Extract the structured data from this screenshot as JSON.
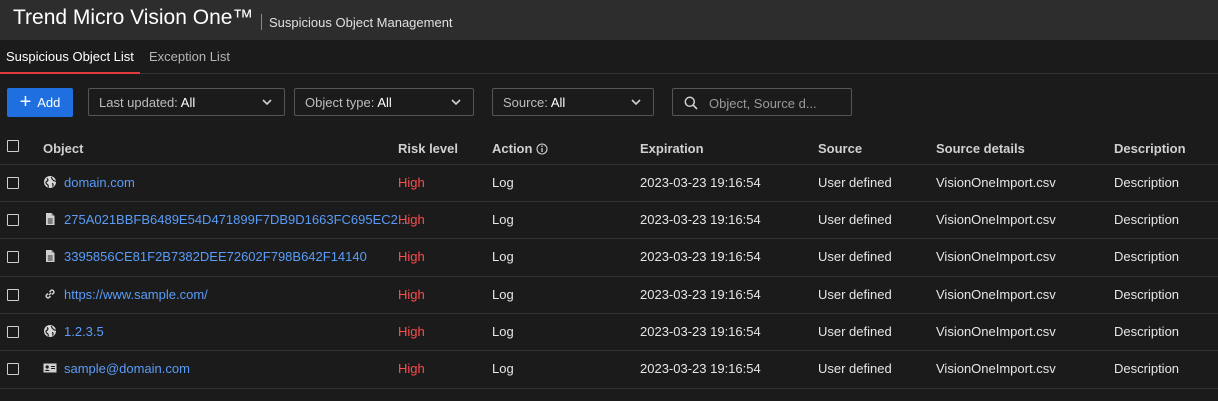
{
  "header": {
    "app_title": "Trend Micro Vision One™",
    "page_title": "Suspicious Object Management"
  },
  "tabs": [
    {
      "label": "Suspicious Object List",
      "active": true
    },
    {
      "label": "Exception List",
      "active": false
    }
  ],
  "toolbar": {
    "add_label": "Add",
    "filters": [
      {
        "label": "Last updated:",
        "value": "All"
      },
      {
        "label": "Object type:",
        "value": "All"
      },
      {
        "label": "Source:",
        "value": "All"
      }
    ],
    "search_placeholder": "Object, Source d..."
  },
  "table": {
    "columns": [
      "Object",
      "Risk level",
      "Action",
      "Expiration",
      "Source",
      "Source details",
      "Description"
    ],
    "rows": [
      {
        "icon": "globe-icon",
        "object": "domain.com",
        "risk": "High",
        "action": "Log",
        "expiration": "2023-03-23 19:16:54",
        "source": "User defined",
        "source_details": "VisionOneImport.csv",
        "description": "Description"
      },
      {
        "icon": "file-icon",
        "object": "275A021BBFB6489E54D471899F7DB9D1663FC695EC2...",
        "risk": "High",
        "action": "Log",
        "expiration": "2023-03-23 19:16:54",
        "source": "User defined",
        "source_details": "VisionOneImport.csv",
        "description": "Description"
      },
      {
        "icon": "file-icon",
        "object": "3395856CE81F2B7382DEE72602F798B642F14140",
        "risk": "High",
        "action": "Log",
        "expiration": "2023-03-23 19:16:54",
        "source": "User defined",
        "source_details": "VisionOneImport.csv",
        "description": "Description"
      },
      {
        "icon": "link-icon",
        "object": "https://www.sample.com/",
        "risk": "High",
        "action": "Log",
        "expiration": "2023-03-23 19:16:54",
        "source": "User defined",
        "source_details": "VisionOneImport.csv",
        "description": "Description"
      },
      {
        "icon": "globe-icon",
        "object": "1.2.3.5",
        "risk": "High",
        "action": "Log",
        "expiration": "2023-03-23 19:16:54",
        "source": "User defined",
        "source_details": "VisionOneImport.csv",
        "description": "Description"
      },
      {
        "icon": "id-card-icon",
        "object": "sample@domain.com",
        "risk": "High",
        "action": "Log",
        "expiration": "2023-03-23 19:16:54",
        "source": "User defined",
        "source_details": "VisionOneImport.csv",
        "description": "Description"
      }
    ]
  },
  "colors": {
    "accent": "#1f6fe0",
    "tab_underline": "#e03a3e",
    "link": "#5a9cf8",
    "risk_high": "#ff4d4f"
  }
}
